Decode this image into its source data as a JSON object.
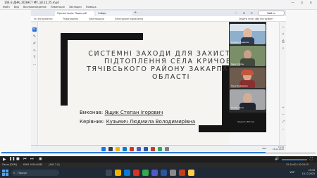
{
  "player": {
    "title": "104-2-ДНК_ЗОЗНСТ МУ_18.12.25.mp4",
    "window_controls": "— ☐ ✕",
    "menu": [
      "Файл",
      "Вид",
      "Воспроизведение",
      "Навигация",
      "Закладки",
      "Помощь"
    ],
    "time_right": "02:10:00 / 02:34:15",
    "progress_fraction": 0.84,
    "status_left": [
      "Пауза [DVM]",
      "H264 1920x1080",
      "[AAC 2.0]"
    ],
    "status_right": "02:10:00 / 02:34:15"
  },
  "recorded_browser": {
    "tabs": [
      "Презентація: Ящик.pdf",
      "Сайди"
    ],
    "new_tab_glyph": "+",
    "window_controls": "— ☐ ✕",
    "join_button": "Вийти",
    "toolbar_items": [
      "Усі інструменти",
      "Редагування",
      "Перетворити",
      "Електронне підписання"
    ],
    "toolbar_right": "Знайти текст або інструмент"
  },
  "slide": {
    "title_lines": [
      "СИСТЕМНІ ЗАХОДИ ДЛЯ ЗАХИСТУ ВІД",
      "ПІДТОПЛЕННЯ СЕЛА КРИЧОВО",
      "ТЯЧІВСЬКОГО РАЙОНУ ЗАКАРПАТСЬКОЇ",
      "ОБЛАСТІ"
    ],
    "author_label": "Виконав:",
    "author_name": "Ящик Степан Ігорович",
    "supervisor_label": "Керівник:",
    "supervisor_name": "Кузьмич Людмила Володимирівна"
  },
  "participants": {
    "tiles": [
      {
        "name": "Кузьмич Людмила"
      },
      {
        "name": "Ящик Степан"
      },
      {
        "name": "Тарас Федорович"
      },
      {
        "name": "Степан Ящик"
      }
    ],
    "bottom_name": "Шумило Віктор"
  },
  "recorded_taskbar": {
    "lang": "УКР",
    "time": "15:11",
    "date": "18.12.2025"
  },
  "host_taskbar": {
    "search_placeholder": "Пошук",
    "search_icon": "⌕",
    "lang": "УКР",
    "time": "15:19",
    "date": "18.12.2025"
  },
  "icons": {
    "play": "▶",
    "pause": "❚❚",
    "stop": "■",
    "prev": "⏮",
    "next": "⏭",
    "frame": "▣",
    "volume": "🔊",
    "fullscreen": "⛶"
  }
}
